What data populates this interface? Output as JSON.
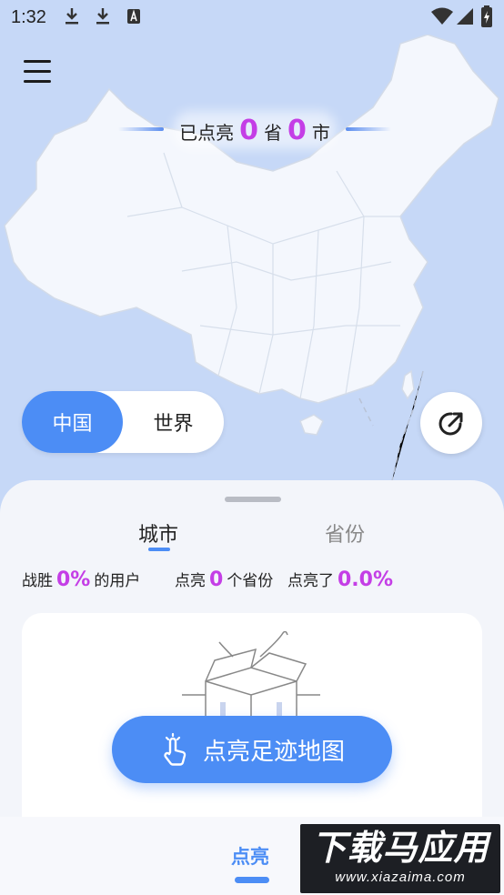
{
  "status_bar": {
    "time": "1:32"
  },
  "banner": {
    "prefix": "已点亮",
    "province_count": "0",
    "province_unit": "省",
    "city_count": "0",
    "city_unit": "市"
  },
  "region_toggle": {
    "options": [
      "中国",
      "世界"
    ],
    "selected": "中国"
  },
  "tabs": [
    {
      "label": "城市",
      "active": true
    },
    {
      "label": "省份",
      "active": false
    }
  ],
  "stats": {
    "beat_prefix": "战胜",
    "beat_value": "0%",
    "beat_suffix": "的用户",
    "lit_prefix": "点亮",
    "lit_value": "0",
    "lit_suffix": "个省份",
    "pct_prefix": "点亮了",
    "pct_value": "0.0%"
  },
  "cta": {
    "label": "点亮足迹地图"
  },
  "bottom_nav": {
    "items": [
      {
        "label": "点亮",
        "active": true
      }
    ]
  },
  "watermark": {
    "main": "下载马应用",
    "sub": "www.xiazaima.com"
  },
  "colors": {
    "accent": "#4c8df5",
    "highlight": "#c43ee6",
    "map_bg": "#c6d8f7",
    "map_land": "#f4f7fd"
  }
}
